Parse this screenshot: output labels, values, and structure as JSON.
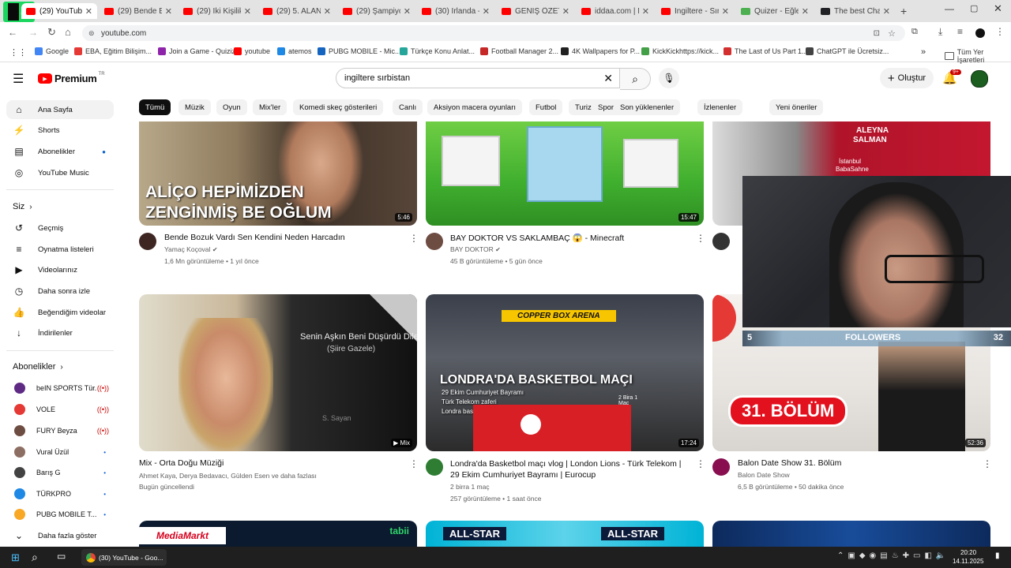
{
  "browser": {
    "tabs": [
      {
        "label": "(29) YouTube",
        "active": true
      },
      {
        "label": "(29) Bende Bozuk"
      },
      {
        "label": "(29) İki Kişilik"
      },
      {
        "label": "(29) 5. ALAN"
      },
      {
        "label": "(29) Şampiyon"
      },
      {
        "label": "(30) İrlanda -"
      },
      {
        "label": "GENİŞ ÖZET: B"
      },
      {
        "label": "iddaa.com | N"
      },
      {
        "label": "İngiltere - Sırb"
      },
      {
        "label": "Quizer - Eğlenc"
      },
      {
        "label": "The best Chatb"
      }
    ],
    "url": "youtube.com",
    "bookmarks": [
      {
        "label": "Google",
        "color": "#4285f4"
      },
      {
        "label": "EBA, Eğitim Bilişim...",
        "color": "#e53935"
      },
      {
        "label": "Join a Game - Quizizz",
        "color": "#8e24aa"
      },
      {
        "label": "youtube",
        "color": "#ff0000"
      },
      {
        "label": "atemos",
        "color": "#1e88e5"
      },
      {
        "label": "PUBG MOBILE - Mic...",
        "color": "#1565c0"
      },
      {
        "label": "Türkçe Konu Anlat...",
        "color": "#26a69a"
      },
      {
        "label": "Football Manager 2...",
        "color": "#c62828"
      },
      {
        "label": "4K Wallpapers for P...",
        "color": "#212121"
      },
      {
        "label": "KickKickhttps://kick...",
        "color": "#43a047"
      },
      {
        "label": "The Last of Us Part 1...",
        "color": "#d32f2f"
      },
      {
        "label": "ChatGPT ile Ücretsiz...",
        "color": "#424242"
      }
    ],
    "bookmarks_extra": "»",
    "all_bookmarks": "Tüm Yer İşaretleri"
  },
  "youtube": {
    "logo": "Premium",
    "logo_region": "TR",
    "search_value": "ingiltere sırbistan",
    "create_label": "Oluştur",
    "notif_badge": "9+",
    "sidebar": {
      "main": [
        {
          "icon": "⌂",
          "label": "Ana Sayfa",
          "active": true
        },
        {
          "icon": "⚡",
          "label": "Shorts"
        },
        {
          "icon": "▤",
          "label": "Abonelikler",
          "dot": true
        },
        {
          "icon": "◎",
          "label": "YouTube Music"
        }
      ],
      "you_header": "Siz",
      "you": [
        {
          "icon": "↺",
          "label": "Geçmiş"
        },
        {
          "icon": "≡",
          "label": "Oynatma listeleri"
        },
        {
          "icon": "▶",
          "label": "Videolarınız"
        },
        {
          "icon": "◷",
          "label": "Daha sonra izle"
        },
        {
          "icon": "👍",
          "label": "Beğendiğim videolar"
        },
        {
          "icon": "↓",
          "label": "İndirilenler"
        }
      ],
      "subs_header": "Abonelikler",
      "subs": [
        {
          "label": "beIN SPORTS Tür...",
          "live": true,
          "color": "#5e2a84"
        },
        {
          "label": "VOLE",
          "live": true,
          "color": "#e53935"
        },
        {
          "label": "FURY Beyza",
          "live": true,
          "color": "#6d4c41"
        },
        {
          "label": "Vural Üzül",
          "dot": true,
          "color": "#8d6e63"
        },
        {
          "label": "Barış G",
          "dot": true,
          "color": "#424242"
        },
        {
          "label": "TÜRKPRO",
          "dot": true,
          "color": "#1e88e5"
        },
        {
          "label": "PUBG MOBILE T...",
          "dot": true,
          "color": "#f9a825"
        }
      ],
      "show_more": "Daha fazla göster"
    },
    "chips": [
      "Tümü",
      "Müzik",
      "Oyun",
      "Mix'ler",
      "Komedi skeç gösterileri",
      "Canlı",
      "Aksiyon macera oyunları",
      "Futbol",
      "Turizm",
      "Spor video oyunları",
      "Son yüklenenler",
      "İzlenenler",
      "Yeni öneriler"
    ],
    "videos": [
      {
        "title": "Bende Bozuk Vardı Sen Kendini Neden Harcadın",
        "channel": "Yamaç Koçoval",
        "verified": true,
        "meta": "1,6 Mn görüntüleme • 1 yıl önce",
        "duration": "5:46",
        "thumb_text": [
          "ALİÇO HEPİMİZDEN",
          "ZENGİNMİŞ BE OĞLUM"
        ],
        "avatar_color": "#3e2723"
      },
      {
        "title": "BAY DOKTOR VS SAKLAMBAÇ 😱 - Minecraft",
        "channel": "BAY DOKTOR",
        "verified": true,
        "meta": "45 B görüntüleme • 5 gün önce",
        "duration": "15:47",
        "avatar_color": "#6d4c41"
      },
      {
        "title": "",
        "channel": "",
        "meta": "",
        "duration": "",
        "thumb_text": [
          "ALEYNA",
          "SALMAN",
          "İstanbul",
          "BabaSahne"
        ],
        "avatar_color": "#333333"
      },
      {
        "title": "Mix - Orta Doğu Müziği",
        "channel": "Ahmet Kaya, Derya Bedavacı, Gülden Esen ve daha fazlası",
        "meta": "Bugün güncellendi",
        "mix_label": "Mix",
        "thumb_text": [
          "Senin Aşkın Beni Düşürdü Dile",
          "(Şiire Gazele)",
          "S. Sayan"
        ]
      },
      {
        "title": "Londra'da Basketbol maçı vlog | London Lions - Türk Telekom | 29 Ekim Cumhuriyet Bayramı | Eurocup",
        "channel": "2 birra 1 maç",
        "meta": "257 görüntüleme • 1 saat önce",
        "duration": "17:24",
        "thumb_text": [
          "COPPER BOX ARENA",
          "LONDRA'DA BASKETBOL MAÇI",
          "29 Ekim Cumhuriyet Bayramı",
          "Türk Telekom zaferi",
          "Londra basketbol kültürü",
          "2 Bira 1 Maç"
        ],
        "avatar_color": "#2e7d32"
      },
      {
        "title": "Balon Date Show 31. Bölüm",
        "channel": "Balon Date Show",
        "meta": "6,5 B görüntüleme • 50 dakika önce",
        "duration": "52:36",
        "thumb_text": [
          "31. BÖLÜM"
        ],
        "avatar_color": "#880e4f"
      }
    ],
    "row3": [
      {
        "thumb_text": [
          "MediaMarkt",
          "tabii"
        ]
      },
      {
        "thumb_text": [
          "ALL-STAR",
          "ALL-STAR"
        ]
      },
      {
        "thumb_text": []
      }
    ]
  },
  "overlay": {
    "counter_left": "5",
    "label": "FOLLOWERS",
    "counter_right": "32",
    "corner_badge": "4"
  },
  "taskbar": {
    "window": "(30) YouTube - Goo...",
    "time": "20:20",
    "date": "14.11.2025"
  }
}
